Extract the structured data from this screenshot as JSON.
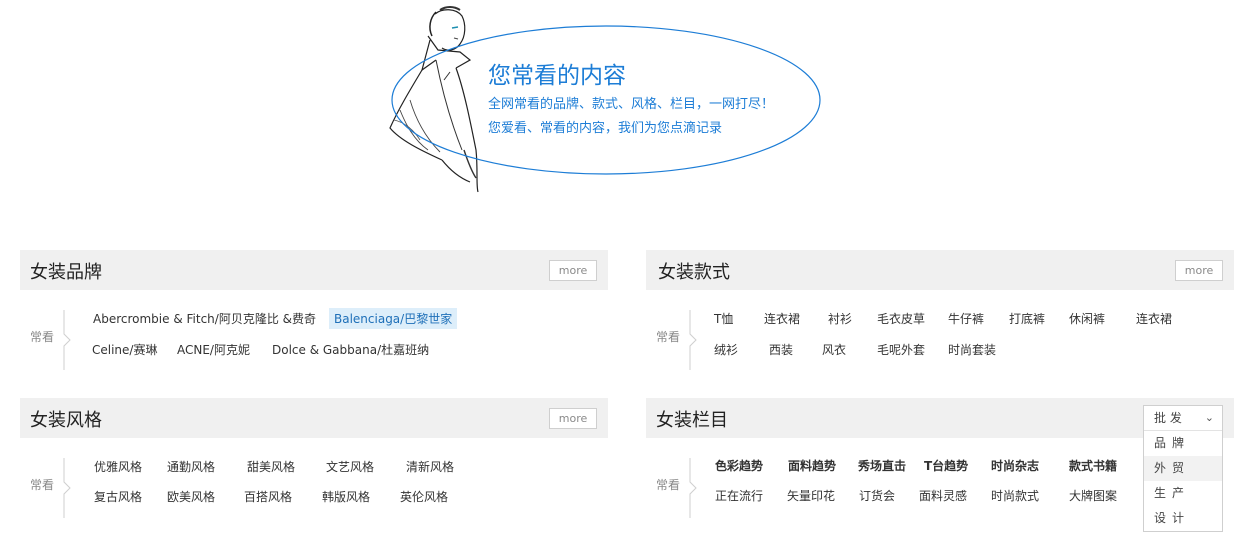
{
  "hero": {
    "title": "您常看的内容",
    "line1": "全网常看的品牌、款式、风格、栏目，一网打尽！",
    "line2": "您爱看、常看的内容，我们为您点滴记录",
    "accent": "#1d7dd6"
  },
  "panels": {
    "brand": {
      "title": "女装品牌",
      "more": "more",
      "often": "常看",
      "items": [
        "Abercrombie & Fitch/阿贝克隆比 &费奇",
        "Balenciaga/巴黎世家",
        "Celine/赛琳",
        "ACNE/阿克妮",
        "Dolce & Gabbana/杜嘉班纳"
      ]
    },
    "style": {
      "title": "女装款式",
      "more": "more",
      "often": "常看",
      "items": [
        "T恤",
        "连衣裙",
        "衬衫",
        "毛衣皮草",
        "牛仔裤",
        "打底裤",
        "休闲裤",
        "连衣裙",
        "绒衫",
        "西装",
        "风衣",
        "毛呢外套",
        "时尚套装"
      ]
    },
    "fengge": {
      "title": "女装风格",
      "more": "more",
      "often": "常看",
      "items": [
        "优雅风格",
        "通勤风格",
        "甜美风格",
        "文艺风格",
        "清新风格",
        "复古风格",
        "欧美风格",
        "百搭风格",
        "韩版风格",
        "英伦风格"
      ]
    },
    "column": {
      "title": "女装栏目",
      "often": "常看",
      "items": [
        "色彩趋势",
        "面料趋势",
        "秀场直击",
        "T台趋势",
        "时尚杂志",
        "款式书籍",
        "正在流行",
        "矢量印花",
        "订货会",
        "面料灵感",
        "时尚款式",
        "大牌图案"
      ]
    }
  },
  "dropdown": {
    "selected": "批 发",
    "options": [
      "品牌",
      "外贸",
      "生产",
      "设计"
    ]
  },
  "colors": {
    "active_bg": "#ddeefa",
    "active_text": "#1e6fb8",
    "header_bg": "#f0f0f0"
  }
}
